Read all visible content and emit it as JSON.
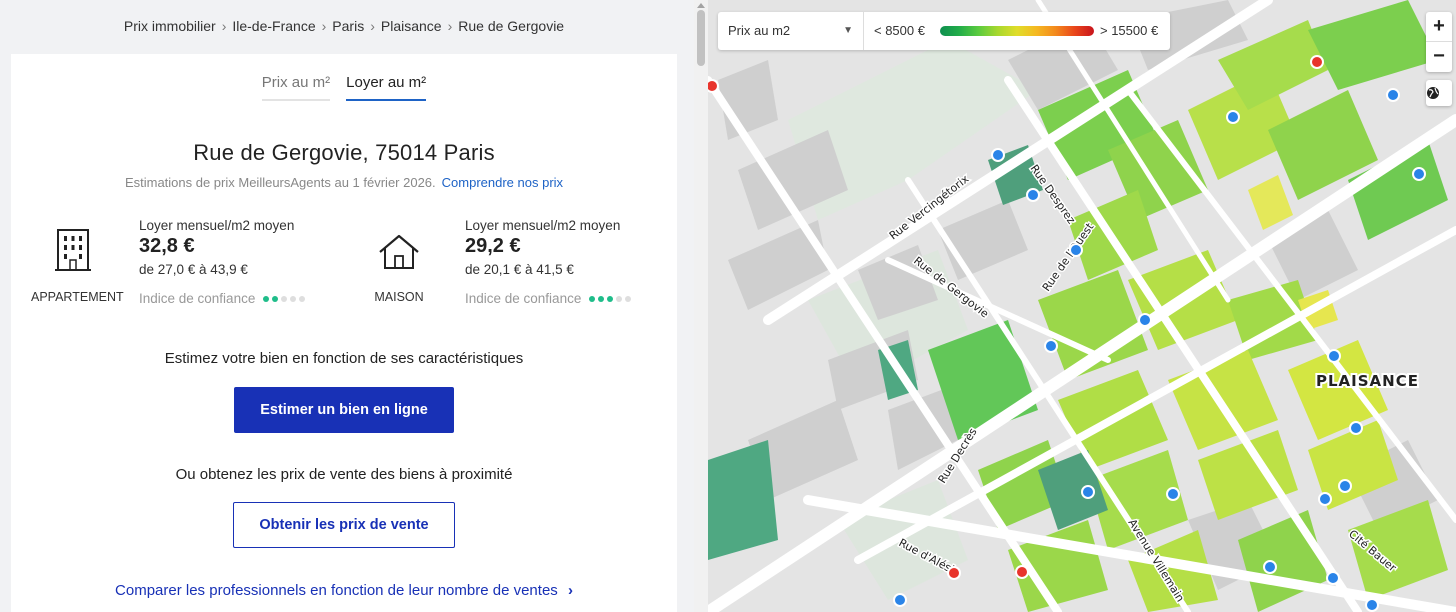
{
  "breadcrumb": [
    "Prix immobilier",
    "Ile-de-France",
    "Paris",
    "Plaisance",
    "Rue de Gergovie"
  ],
  "tabs": [
    {
      "label": "Prix au m²",
      "active": false
    },
    {
      "label": "Loyer au m²",
      "active": true
    }
  ],
  "title": "Rue de Gergovie, 75014 Paris",
  "subtitle": "Estimations de prix MeilleursAgents au 1 février 2026.",
  "subtitle_link": "Comprendre nos prix",
  "properties": [
    {
      "type": "APPARTEMENT",
      "icon": "building-icon",
      "label": "Loyer mensuel/m2 moyen",
      "value": "32,8 €",
      "range": "de 27,0 € à 43,9 €",
      "confidence_label": "Indice de confiance",
      "confidence_level": 2,
      "confidence_max": 5
    },
    {
      "type": "MAISON",
      "icon": "house-icon",
      "label": "Loyer mensuel/m2 moyen",
      "value": "29,2 €",
      "range": "de 20,1 € à 41,5 €",
      "confidence_label": "Indice de confiance",
      "confidence_level": 3,
      "confidence_max": 5
    }
  ],
  "estimate_text": "Estimez votre bien en fonction de ses caractéristiques",
  "estimate_button": "Estimer un bien en ligne",
  "or_text": "Ou obtenez les prix de vente des biens à proximité",
  "sales_button": "Obtenir les prix de vente",
  "compare_link": "Comparer les professionnels en fonction de leur nombre de ventes",
  "map": {
    "select_value": "Prix au m2",
    "legend_low": "< 8500 €",
    "legend_high": "> 15500 €",
    "zoom_in": "+",
    "zoom_out": "−",
    "district": "PLAISANCE",
    "streets": [
      "Rue Vercingétorix",
      "Rue Desprez",
      "Rue de Gergovie",
      "Rue de l'Ouest",
      "Rue Decrès",
      "Rue d'Alésia",
      "Avenue Villemain",
      "Cité Bauer"
    ],
    "colors": {
      "accent": "#1831b6",
      "link": "#1e63c6",
      "confidence": "#1fbd8a",
      "marker_blue": "#2a84e8",
      "marker_red": "#e8342c"
    }
  }
}
